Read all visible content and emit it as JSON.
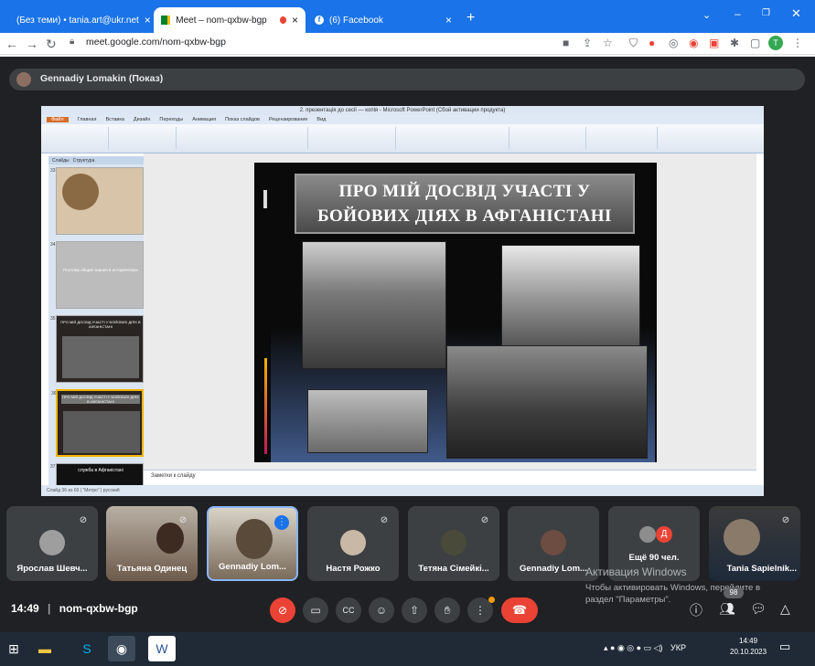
{
  "browser": {
    "tabs": [
      {
        "label": "(Без теми) • tania.art@ukr.net",
        "active": false
      },
      {
        "label": "Meet – nom-qxbw-bgp",
        "active": true
      },
      {
        "label": "(6) Facebook",
        "active": false
      }
    ],
    "new_tab": "+",
    "url": "meet.google.com/nom-qxbw-bgp",
    "profile_initial": "T"
  },
  "meet": {
    "presenter_label": "Gennadiy Lomakin (Показ)",
    "powerpoint": {
      "window_title": "2. презентація до сесії — копія - Microsoft PowerPoint (Сбой активации продукта)",
      "ribbon_tabs": [
        "Файл",
        "Главная",
        "Вставка",
        "Дизайн",
        "Переходы",
        "Анимация",
        "Показ слайдов",
        "Рецензирование",
        "Вид"
      ],
      "panel_tabs": [
        "Слайды",
        "Структура"
      ],
      "thumb_numbers": [
        "33",
        "34",
        "35",
        "36",
        "37"
      ],
      "thumb_captions": [
        "Поэтому общие знания в исторических",
        "ПРО МІЙ ДОСВІД УЧАСТІ У БОЙОВИХ ДІЯХ В АФГАНІСТАНІ",
        "служба в Афганістані"
      ],
      "slide_title": "ПРО МІЙ ДОСВІД УЧАСТІ У БОЙОВИХ ДІЯХ В АФГАНІСТАНІ",
      "notes_placeholder": "Заметки к слайду",
      "status_text": "Слайд 36 из 60 | \"Метро\" | русский"
    },
    "participants": [
      {
        "name": "Ярослав Шевч...",
        "muted": true
      },
      {
        "name": "Татьяна Одинец",
        "muted": true
      },
      {
        "name": "Gennadiy Lom...",
        "muted": false
      },
      {
        "name": "Настя Рожко",
        "muted": true
      },
      {
        "name": "Тетяна Сімейкі...",
        "muted": true
      },
      {
        "name": "Gennadiy Lom...",
        "muted": false
      },
      {
        "name": "Ещё 90 чел.",
        "muted": false
      },
      {
        "name": "Tania Sapielnik...",
        "muted": true
      }
    ],
    "more_badge": "Д",
    "bottom": {
      "time": "14:49",
      "meeting_code": "nom-qxbw-bgp",
      "people_count": "98"
    },
    "activation_title": "Активация Windows",
    "activation_text": "Чтобы активировать Windows, перейдите в раздел \"Параметры\"."
  },
  "taskbar": {
    "language": "УКР",
    "time": "14:49",
    "date": "20.10.2023"
  },
  "colors": {
    "chrome_blue": "#1a73e8",
    "meet_bg": "#202124",
    "end_call_red": "#ea4335",
    "active_speaker": "#8ab4f8"
  }
}
